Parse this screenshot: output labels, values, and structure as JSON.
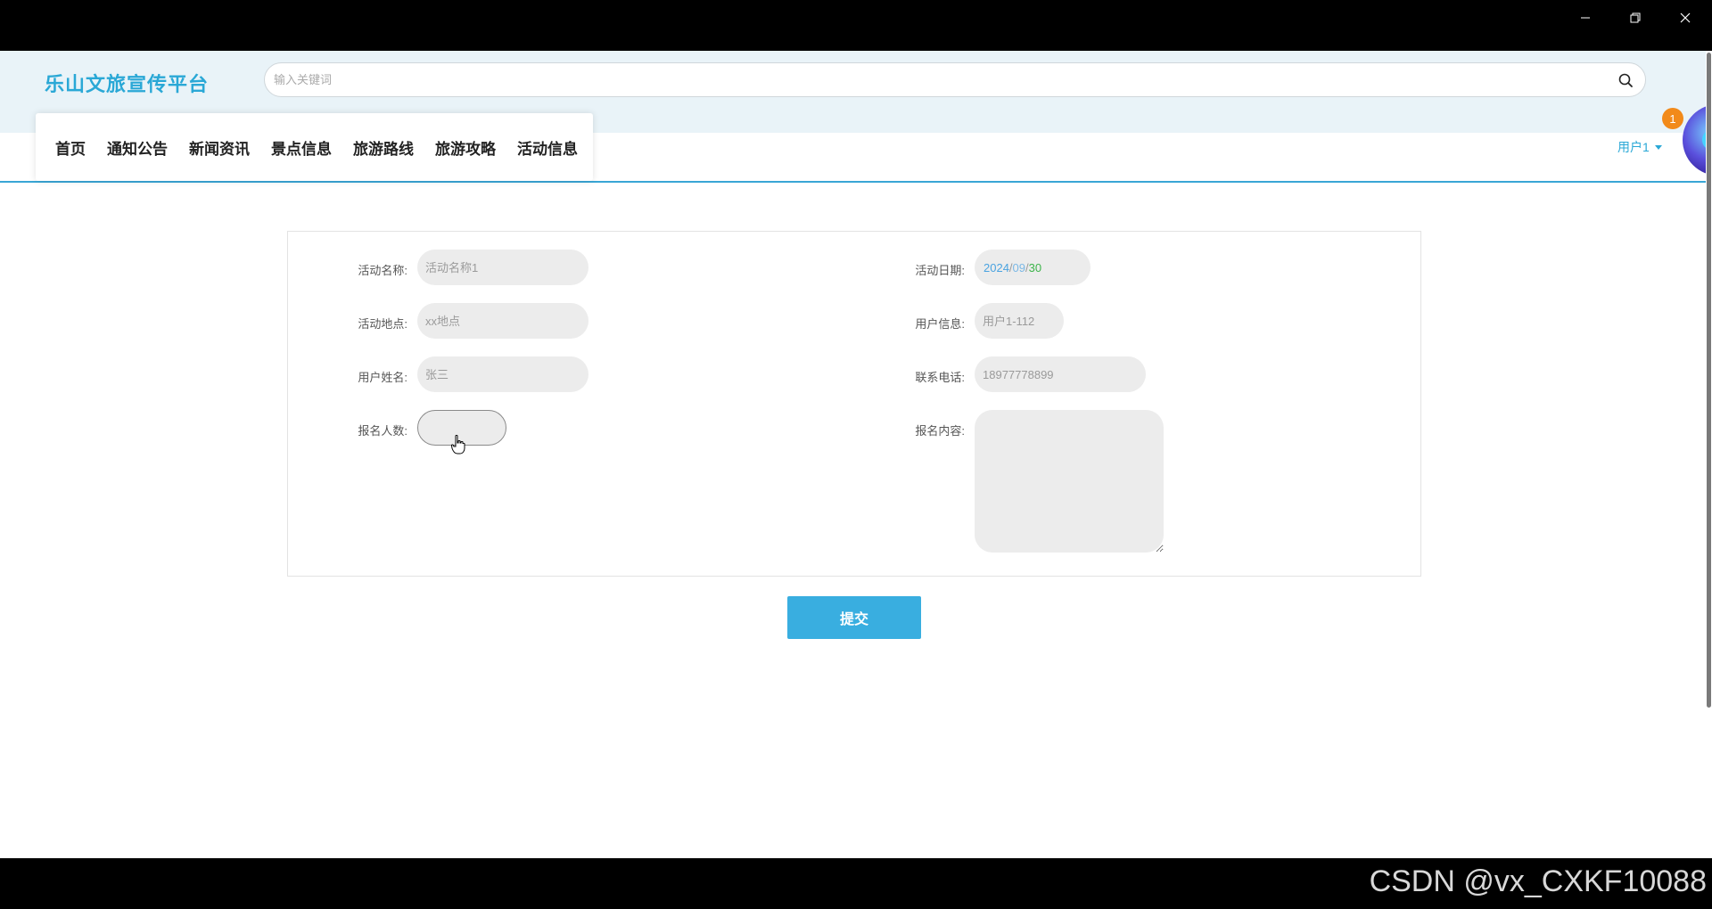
{
  "window": {
    "min_icon": "minimize-icon",
    "max_icon": "restore-icon",
    "close_icon": "close-icon"
  },
  "header": {
    "brand": "乐山文旅宣传平台",
    "search_placeholder": "输入关键词",
    "search_icon": "search-icon"
  },
  "nav": {
    "items": [
      "首页",
      "通知公告",
      "新闻资讯",
      "景点信息",
      "旅游路线",
      "旅游攻略",
      "活动信息"
    ]
  },
  "user": {
    "label": "用户1",
    "badge_count": "1"
  },
  "form": {
    "activity_name_label": "活动名称:",
    "activity_name_value": "活动名称1",
    "activity_date_label": "活动日期:",
    "activity_date_year": "2024",
    "activity_date_month": "09",
    "activity_date_day": "30",
    "date_sep": "/",
    "location_label": "活动地点:",
    "location_value": "xx地点",
    "user_info_label": "用户信息:",
    "user_info_value": "用户1-112",
    "user_name_label": "用户姓名:",
    "user_name_value": "张三",
    "phone_label": "联系电话:",
    "phone_value": "18977778899",
    "count_label": "报名人数:",
    "count_value": "",
    "content_label": "报名内容:",
    "content_value": ""
  },
  "submit_label": "提交",
  "watermark": "CSDN @vx_CXKF10088",
  "colors": {
    "brand": "#2aa8d6",
    "accent": "#39aee0",
    "band": "#e9f3f8",
    "badge": "#f28a1a"
  }
}
